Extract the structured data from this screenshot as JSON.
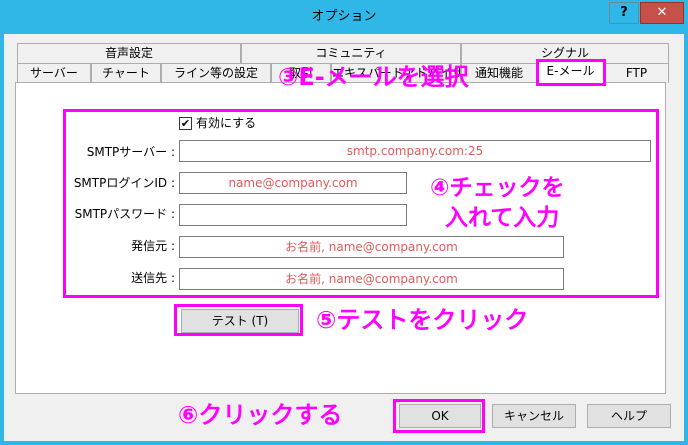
{
  "window": {
    "title": "オプション",
    "help_label": "?",
    "close_label": "✕"
  },
  "tabs_row1": [
    "音声設定",
    "コミュニティ",
    "シグナル"
  ],
  "tabs_row2": [
    "サーバー",
    "チャート",
    "ライン等の設定",
    "取引",
    "エキスパートアドバイザ",
    "通知機能",
    "E-メール",
    "FTP"
  ],
  "active_tab": "E-メール",
  "form": {
    "enable_label": "有効にする",
    "enable_checked": "✔",
    "smtp_server_label": "SMTPサーバー :",
    "smtp_server_value": "smtp.company.com:25",
    "smtp_login_label": "SMTPログインID :",
    "smtp_login_value": "name@company.com",
    "smtp_password_label": "SMTPパスワード :",
    "smtp_password_value": "",
    "from_label": "発信元 :",
    "from_value": "お名前, name@company.com",
    "to_label": "送信先 :",
    "to_value": "お名前, name@company.com",
    "test_label": "テスト (T)"
  },
  "buttons": {
    "ok": "OK",
    "cancel": "キャンセル",
    "help": "ヘルプ"
  },
  "annotations": {
    "step3": "③E-メールを選択",
    "step4_line1": "④チェックを",
    "step4_line2": "入れて入力",
    "step5": "⑤テストをクリック",
    "step6": "⑥クリックする"
  },
  "colors": {
    "titlebar": "#2fb7e8",
    "annotation": "#ff00ff",
    "placeholder_text": "#e05a5a",
    "close_button": "#c7504b"
  }
}
